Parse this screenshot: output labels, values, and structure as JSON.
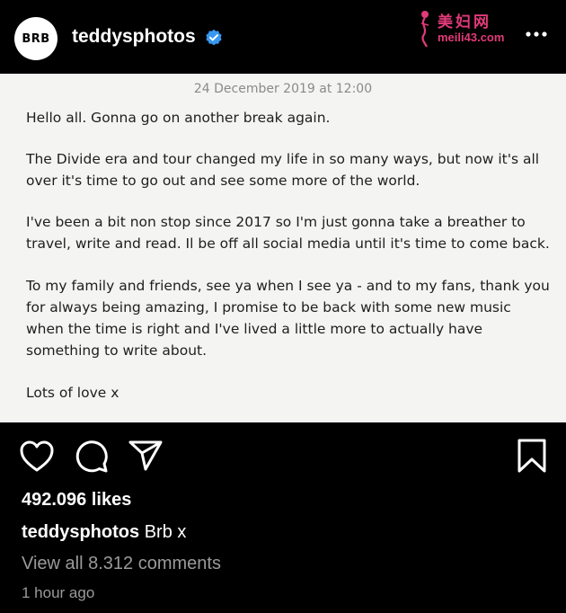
{
  "header": {
    "avatar_text": "BRB",
    "username": "teddysphotos",
    "verified_icon": "verified-badge-icon",
    "more_icon": "more-options-icon",
    "watermark": {
      "chinese": "美妇网",
      "url": "meili43.com"
    },
    "colors": {
      "verified": "#3897f0",
      "watermark": "#e23a78"
    }
  },
  "post": {
    "date": "24 December 2019 at 12:00",
    "paragraphs": [
      [
        "Hello all. Gonna go on another break again."
      ],
      [
        "The Divide era and tour changed my life in so many ways, but now it's all",
        "over it's time to go out and see some more of the world."
      ],
      [
        "I've been a bit non stop since 2017 so I'm just gonna take a breather to",
        "travel, write and read. Il be off all social media until it's time to come back."
      ],
      [
        "To my family and friends, see ya when I see ya - and to my fans, thank you",
        "for always being amazing, I promise to be back with some new music",
        "when the time is right and I've lived a little more to actually have",
        "something to write about."
      ],
      [
        "Lots of love x"
      ]
    ]
  },
  "actions": {
    "icons": [
      "heart-icon",
      "comment-icon",
      "share-icon",
      "bookmark-icon"
    ]
  },
  "footer": {
    "likes": "492.096 likes",
    "caption_user": "teddysphotos",
    "caption_text": "Brb x",
    "view_comments": "View all 8.312 comments",
    "time_ago": "1 hour ago"
  }
}
